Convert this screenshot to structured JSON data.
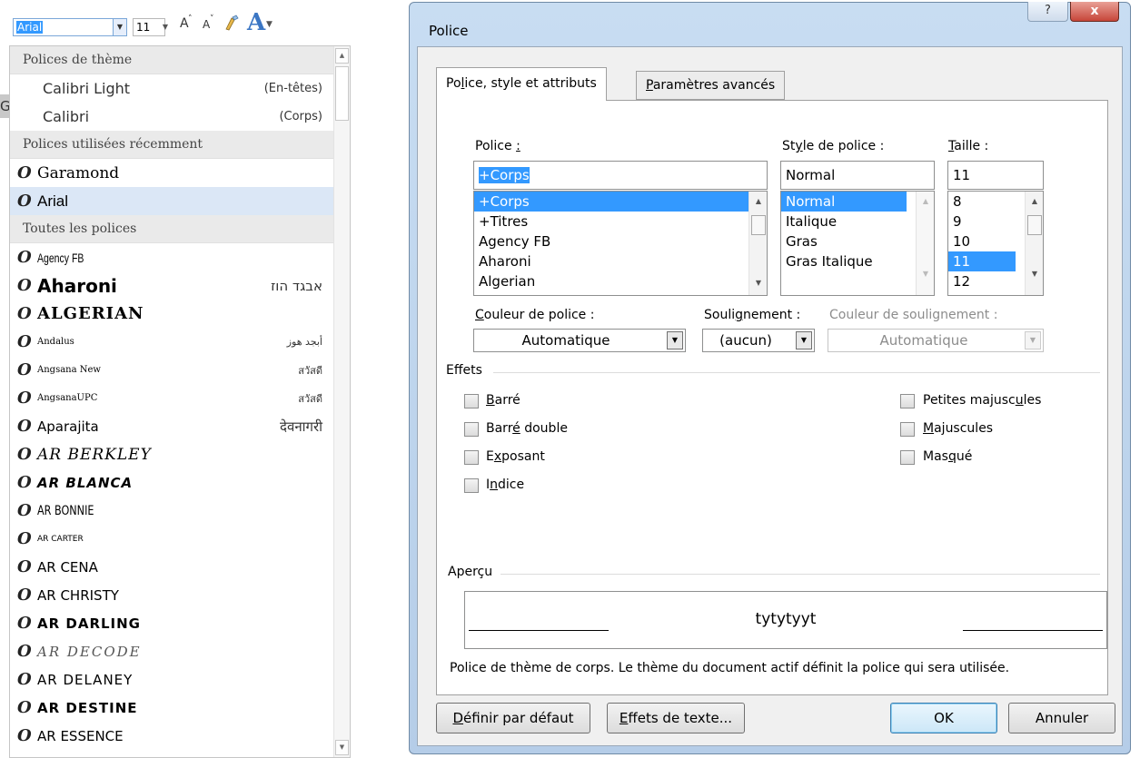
{
  "ribbon": {
    "font_value": "Arial",
    "size_value": "11",
    "grow_font_icon": "A",
    "shrink_font_icon": "A",
    "clear_format_icon": "brush-icon",
    "text_effects_icon": "A"
  },
  "font_dropdown": {
    "theme_header": "Polices de thème",
    "theme_fonts": [
      {
        "name": "Calibri Light",
        "role": "(En-têtes)"
      },
      {
        "name": "Calibri",
        "role": "(Corps)"
      }
    ],
    "recent_header": "Polices utilisées récemment",
    "recent_fonts": [
      "Garamond",
      "Arial"
    ],
    "all_header": "Toutes les polices",
    "all_fonts": [
      {
        "name": "Agency FB",
        "sample": ""
      },
      {
        "name": "Aharoni",
        "sample": "אבגד הוז"
      },
      {
        "name": "ALGERIAN",
        "sample": ""
      },
      {
        "name": "Andalus",
        "sample": "أبجد هوز"
      },
      {
        "name": "Angsana New",
        "sample": "สวัสดี"
      },
      {
        "name": "AngsanaUPC",
        "sample": "สวัสดี"
      },
      {
        "name": "Aparajita",
        "sample": "देवनागरी"
      },
      {
        "name": "AR BERKLEY",
        "sample": ""
      },
      {
        "name": "AR BLANCA",
        "sample": ""
      },
      {
        "name": "AR BONNIE",
        "sample": ""
      },
      {
        "name": "AR CARTER",
        "sample": ""
      },
      {
        "name": "AR CENA",
        "sample": ""
      },
      {
        "name": "AR CHRISTY",
        "sample": ""
      },
      {
        "name": "AR DARLING",
        "sample": ""
      },
      {
        "name": "AR DECODE",
        "sample": ""
      },
      {
        "name": "AR DELANEY",
        "sample": ""
      },
      {
        "name": "AR DESTINE",
        "sample": ""
      },
      {
        "name": "AR ESSENCE",
        "sample": ""
      }
    ],
    "font_icon": "O",
    "side_char": "G"
  },
  "dialog": {
    "title": "Police",
    "help_icon": "?",
    "close_icon": "x",
    "tabs": [
      {
        "pre": "Po",
        "ul": "l",
        "post": "ice, style et attributs"
      },
      {
        "pre": "",
        "ul": "P",
        "post": "aramètres avancés"
      }
    ],
    "font_label": {
      "pre": "Police ",
      "ul": ":",
      "post": ""
    },
    "font_value": "+Corps",
    "font_list": [
      "+Corps",
      "+Titres",
      "Agency FB",
      "Aharoni",
      "Algerian"
    ],
    "style_label": {
      "pre": "St",
      "ul": "y",
      "post": "le de police :"
    },
    "style_value": "Normal",
    "style_list": [
      "Normal",
      "Italique",
      "Gras",
      "Gras Italique"
    ],
    "size_label": {
      "pre": "",
      "ul": "T",
      "post": "aille :"
    },
    "size_value": "11",
    "size_list": [
      "8",
      "9",
      "10",
      "11",
      "12"
    ],
    "color_label": {
      "pre": "",
      "ul": "C",
      "post": "ouleur de police :"
    },
    "color_value": "Automatique",
    "underline_label": {
      "pre": "Souli",
      "ul": "g",
      "post": "nement :"
    },
    "underline_value": "(aucun)",
    "underline_color_label": "Couleur de soulignement :",
    "underline_color_value": "Automatique",
    "effects_label": "Effets",
    "effects_left": [
      {
        "pre": "",
        "ul": "B",
        "post": "arré"
      },
      {
        "pre": "Barr",
        "ul": "é",
        "post": " double"
      },
      {
        "pre": "E",
        "ul": "x",
        "post": "posant"
      },
      {
        "pre": "I",
        "ul": "n",
        "post": "dice"
      }
    ],
    "effects_right": [
      {
        "pre": "Petites majusc",
        "ul": "u",
        "post": "les"
      },
      {
        "pre": "",
        "ul": "M",
        "post": "ajuscules"
      },
      {
        "pre": "Mas",
        "ul": "q",
        "post": "ué"
      }
    ],
    "preview_label": "Aperçu",
    "preview_text": "tytytyyt",
    "preview_desc": "Police de thème de corps. Le thème du document actif définit la police qui sera utilisée.",
    "btn_default": {
      "pre": "",
      "ul": "D",
      "post": "éfinir par défaut"
    },
    "btn_effects": {
      "pre": "",
      "ul": "E",
      "post": "ffets de texte..."
    },
    "btn_ok": "OK",
    "btn_cancel": "Annuler"
  }
}
